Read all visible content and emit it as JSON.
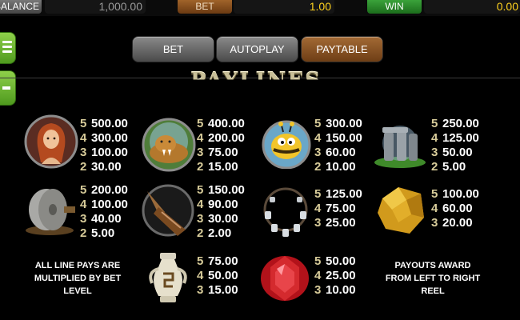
{
  "status_bar": {
    "balance_label": "BALANCE",
    "balance_value": "1,000.00",
    "bet_label": "BET",
    "bet_value": "1.00",
    "win_label": "WIN",
    "win_value": "0.00"
  },
  "side_buttons": {
    "menu_icon": "hamburger-icon",
    "minus_icon": "minus-icon"
  },
  "tabs": {
    "bet": "BET",
    "autoplay": "AUTOPLAY",
    "paytable": "PAYTABLE",
    "active": "paytable"
  },
  "paytable": {
    "title": "PAYLINES",
    "symbols": [
      {
        "name": "cavewoman",
        "pays": [
          {
            "count": "5",
            "amount": "500.00"
          },
          {
            "count": "4",
            "amount": "300.00"
          },
          {
            "count": "3",
            "amount": "100.00"
          },
          {
            "count": "2",
            "amount": "30.00"
          }
        ]
      },
      {
        "name": "sabertooth-cat",
        "pays": [
          {
            "count": "5",
            "amount": "400.00"
          },
          {
            "count": "4",
            "amount": "200.00"
          },
          {
            "count": "3",
            "amount": "75.00"
          },
          {
            "count": "2",
            "amount": "15.00"
          }
        ]
      },
      {
        "name": "bee",
        "pays": [
          {
            "count": "5",
            "amount": "300.00"
          },
          {
            "count": "4",
            "amount": "150.00"
          },
          {
            "count": "3",
            "amount": "60.00"
          },
          {
            "count": "2",
            "amount": "10.00"
          }
        ]
      },
      {
        "name": "stone-monument",
        "pays": [
          {
            "count": "5",
            "amount": "250.00"
          },
          {
            "count": "4",
            "amount": "125.00"
          },
          {
            "count": "3",
            "amount": "50.00"
          },
          {
            "count": "2",
            "amount": "5.00"
          }
        ]
      },
      {
        "name": "stone-wheel",
        "pays": [
          {
            "count": "5",
            "amount": "200.00"
          },
          {
            "count": "4",
            "amount": "100.00"
          },
          {
            "count": "3",
            "amount": "40.00"
          },
          {
            "count": "2",
            "amount": "5.00"
          }
        ]
      },
      {
        "name": "club",
        "pays": [
          {
            "count": "5",
            "amount": "150.00"
          },
          {
            "count": "4",
            "amount": "90.00"
          },
          {
            "count": "3",
            "amount": "30.00"
          },
          {
            "count": "2",
            "amount": "2.00"
          }
        ]
      },
      {
        "name": "bone-necklace",
        "pays": [
          {
            "count": "5",
            "amount": "125.00"
          },
          {
            "count": "4",
            "amount": "75.00"
          },
          {
            "count": "3",
            "amount": "25.00"
          }
        ]
      },
      {
        "name": "gold-nugget",
        "pays": [
          {
            "count": "5",
            "amount": "100.00"
          },
          {
            "count": "4",
            "amount": "60.00"
          },
          {
            "count": "3",
            "amount": "20.00"
          }
        ]
      },
      {
        "name": "amphora",
        "pays": [
          {
            "count": "5",
            "amount": "75.00"
          },
          {
            "count": "4",
            "amount": "50.00"
          },
          {
            "count": "3",
            "amount": "15.00"
          }
        ]
      },
      {
        "name": "ruby",
        "pays": [
          {
            "count": "5",
            "amount": "50.00"
          },
          {
            "count": "4",
            "amount": "25.00"
          },
          {
            "count": "3",
            "amount": "10.00"
          }
        ]
      }
    ],
    "note_left_lines": [
      "ALL LINE PAYS ARE",
      "MULTIPLIED BY BET",
      "LEVEL"
    ],
    "note_right_lines": [
      "PAYOUTS AWARD",
      "FROM LEFT TO RIGHT",
      "REEL"
    ]
  }
}
